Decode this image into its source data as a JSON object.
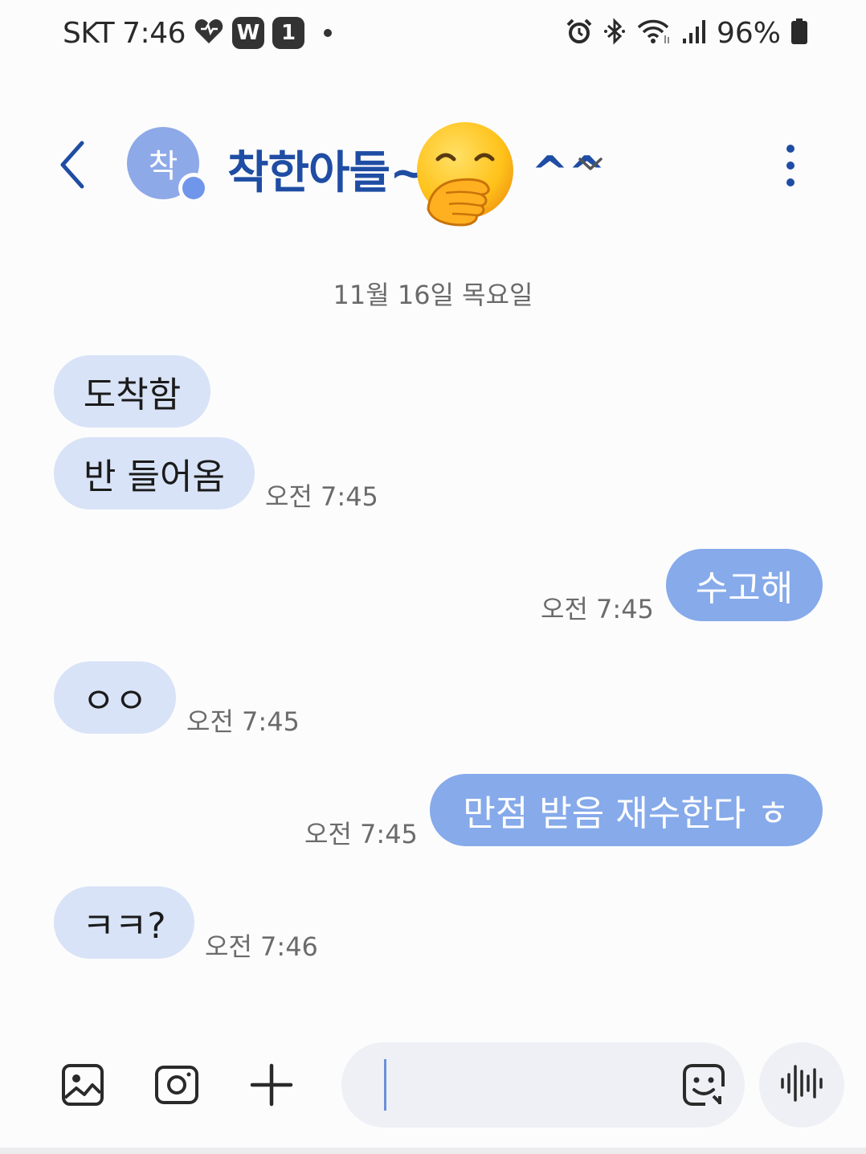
{
  "status_bar": {
    "carrier": "SKT",
    "time": "7:46",
    "badge_w": "W",
    "badge_1": "1",
    "battery_percent": "96%",
    "icons": [
      "heart-icon",
      "alarm-icon",
      "bluetooth-icon",
      "wifi-icon",
      "signal-icon",
      "battery-icon"
    ]
  },
  "header": {
    "avatar_initial": "착",
    "contact_name": "착한아들~",
    "contact_name_suffix": "^^",
    "emoji_icon": "face-with-hand-over-mouth-icon"
  },
  "date_separator": "11월 16일 목요일",
  "messages": [
    {
      "side": "received",
      "text": "도착함",
      "time": ""
    },
    {
      "side": "received",
      "text": "반 들어옴",
      "time": "오전 7:45"
    },
    {
      "side": "sent",
      "text": "수고해",
      "time": "오전 7:45"
    },
    {
      "side": "received",
      "text": "ㅇㅇ",
      "time": "오전 7:45"
    },
    {
      "side": "sent",
      "text": "만점 받음 재수한다 ㅎ",
      "time": "오전 7:45"
    },
    {
      "side": "received",
      "text": "ㅋㅋ?",
      "time": "오전 7:46"
    }
  ],
  "composer": {
    "value": "",
    "icons": [
      "gallery-icon",
      "camera-icon",
      "plus-icon",
      "sticker-icon",
      "voice-icon"
    ]
  },
  "colors": {
    "accent": "#1f4da3",
    "received_bubble": "#d8e3f7",
    "sent_bubble": "#86aaea",
    "avatar": "#8ea9e8"
  }
}
